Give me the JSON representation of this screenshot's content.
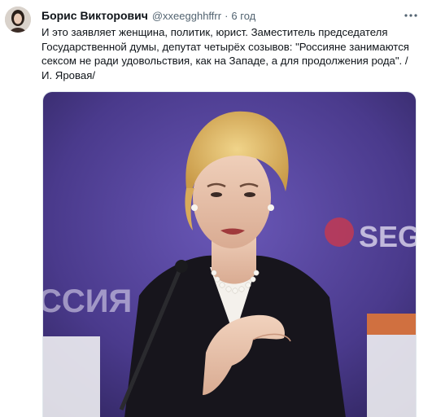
{
  "tweet": {
    "author_name": "Борис Викторович",
    "author_handle": "@xxeegghhffrr",
    "separator": "·",
    "timestamp": "6 год",
    "text": "И это заявляет женщина, политик, юрист. Заместитель председателя Государственной думы, депутат четырёх созывов:  \"Россияне занимаются сексом не ради удовольствия, как на Западе, а для продолжения рода\". /И. Яровая/"
  },
  "media": {
    "backdrop_text_left": "ССИЯ",
    "backdrop_text_right": "SEGO"
  },
  "icons": {
    "more": "more-horizontal-icon",
    "avatar": "avatar-image"
  },
  "colors": {
    "text_primary": "#0f1419",
    "text_secondary": "#536471",
    "backdrop_purple": "#4a3a8c"
  }
}
